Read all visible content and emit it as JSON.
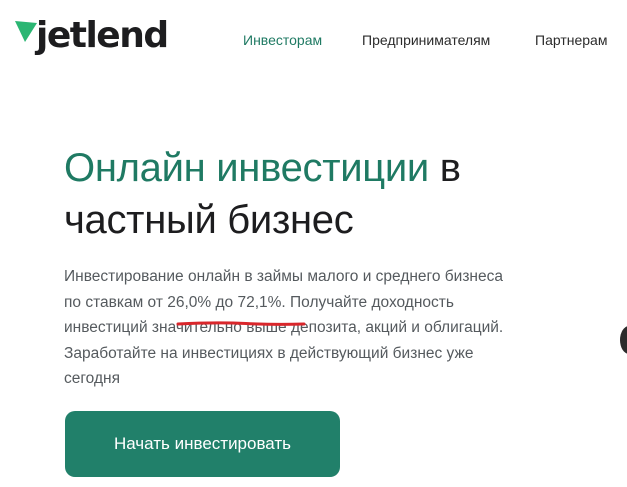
{
  "brand": {
    "name": "jetlend",
    "color": "#21806a"
  },
  "nav": {
    "items": [
      {
        "label": "Инвесторам",
        "active": true
      },
      {
        "label": "Предпринимателям",
        "active": false
      },
      {
        "label": "Партнерам",
        "active": false
      }
    ]
  },
  "hero": {
    "title_accent": "Онлайн инвестиции",
    "title_rest_line1": " в",
    "title_line2": "частный бизнес",
    "description_lines": [
      "Инвестирование онлайн в займы малого и среднего бизнеса",
      "по ставкам от 26,0% до 72,1%. Получайте доходность",
      "инвестиций значительно выше депозита, акций и облигаций.",
      "Заработайте на инвестициях в действующий бизнес уже",
      "сегодня"
    ],
    "highlight_color": "#d9262b",
    "cta_label": "Начать инвестировать"
  }
}
